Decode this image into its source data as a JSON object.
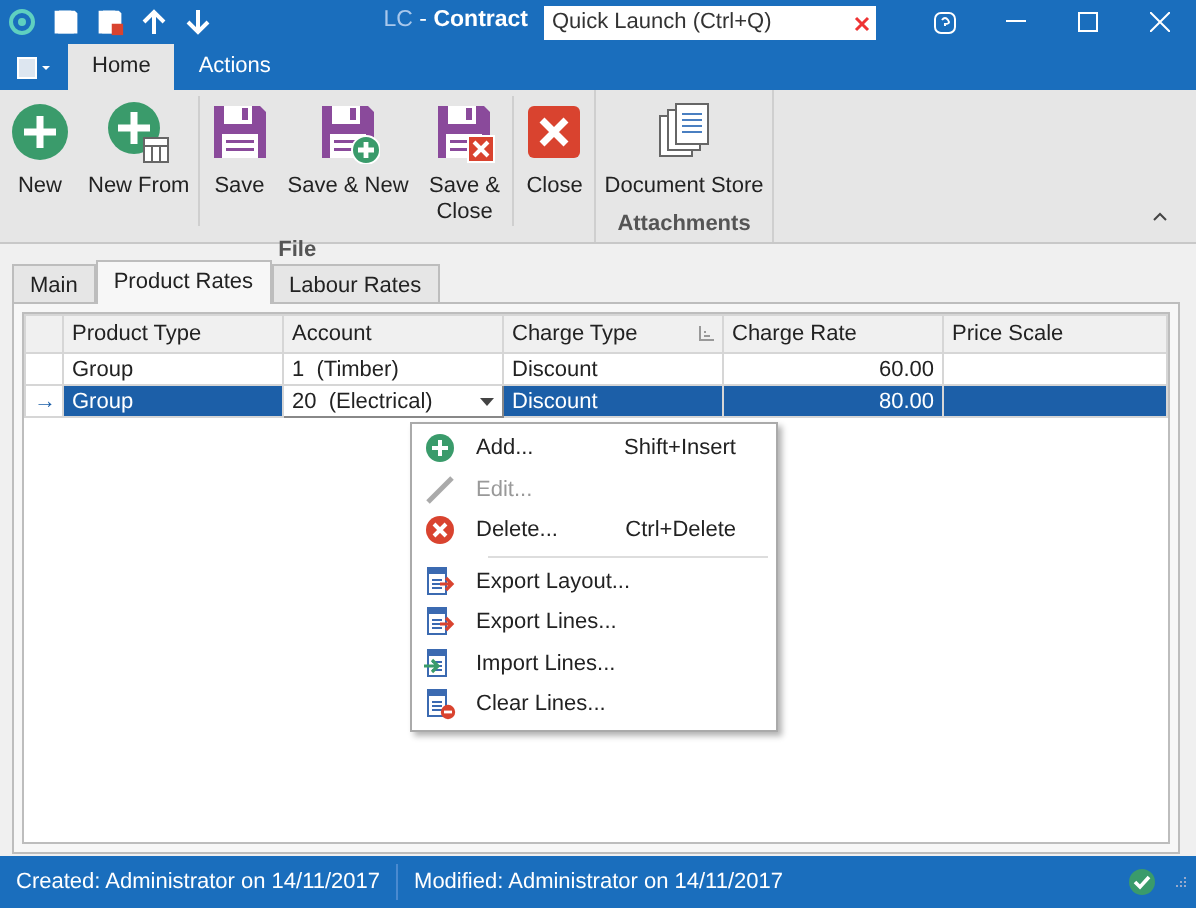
{
  "window": {
    "app": "LC",
    "separator": "-",
    "title": "Contract",
    "quick_launch": {
      "placeholder": "Quick Launch (Ctrl+Q)"
    }
  },
  "ribbon": {
    "tabs": [
      {
        "label": "Home",
        "selected": true
      },
      {
        "label": "Actions",
        "selected": false
      }
    ],
    "groups": [
      {
        "label": "File",
        "sections": [
          [
            {
              "label": "New",
              "kind": "new"
            },
            {
              "label": "New From",
              "kind": "newfrom"
            }
          ],
          [
            {
              "label": "Save",
              "kind": "save"
            },
            {
              "label": "Save & New",
              "kind": "savenew"
            },
            {
              "label": "Save & Close",
              "kind": "saveclose"
            }
          ],
          [
            {
              "label": "Close",
              "kind": "close"
            }
          ]
        ]
      },
      {
        "label": "Attachments",
        "sections": [
          [
            {
              "label": "Document Store",
              "kind": "docs"
            }
          ]
        ]
      }
    ]
  },
  "page_tabs": [
    {
      "label": "Main",
      "selected": false
    },
    {
      "label": "Product Rates",
      "selected": true
    },
    {
      "label": "Labour Rates",
      "selected": false
    }
  ],
  "table": {
    "columns": [
      "Product Type",
      "Account",
      "Charge Type",
      "Charge Rate",
      "Price Scale"
    ],
    "rows": [
      {
        "selected": false,
        "cells": [
          {
            "text": "Group",
            "editing": false
          },
          {
            "text": "1  (Timber)",
            "editing": false
          },
          {
            "text": "Discount",
            "editing": false
          },
          {
            "text": "60.00",
            "editing": false
          },
          {
            "text": "",
            "editing": false
          }
        ]
      },
      {
        "selected": true,
        "indicator": "→",
        "cells": [
          {
            "text": "Group",
            "editing": false
          },
          {
            "text": "20  (Electrical)",
            "editing": true
          },
          {
            "text": "Discount",
            "editing": false
          },
          {
            "text": "80.00",
            "editing": false
          },
          {
            "text": "",
            "editing": false
          }
        ]
      }
    ]
  },
  "context_menu": [
    {
      "kind": "add",
      "label": "Add...",
      "shortcut": "Shift+Insert",
      "disabled": false
    },
    {
      "kind": "edit",
      "label": "Edit...",
      "disabled": true
    },
    {
      "kind": "delete",
      "label": "Delete...",
      "shortcut": "Ctrl+Delete",
      "disabled": false
    },
    {
      "kind": "separator"
    },
    {
      "kind": "export",
      "label": "Export Layout...",
      "disabled": false
    },
    {
      "kind": "export",
      "label": "Export Lines...",
      "disabled": false
    },
    {
      "kind": "import",
      "label": "Import Lines...",
      "disabled": false
    },
    {
      "kind": "clear",
      "label": "Clear Lines...",
      "disabled": false
    }
  ],
  "status_bar": {
    "created": "Created: Administrator on 14/11/2017",
    "modified": "Modified: Administrator on 14/11/2017"
  }
}
